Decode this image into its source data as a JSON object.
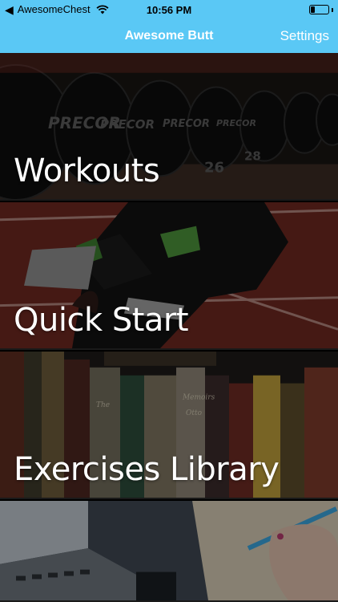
{
  "status_bar": {
    "back_glyph": "◀",
    "carrier": "AwesomeChest",
    "time": "10:56 PM",
    "battery_level": 0.25
  },
  "nav": {
    "title": "Awesome Butt",
    "settings_label": "Settings"
  },
  "menu": {
    "items": [
      {
        "label": "Workouts",
        "image": "dumbbells-photo"
      },
      {
        "label": "Quick Start",
        "image": "sprinter-start-photo"
      },
      {
        "label": "Exercises Library",
        "image": "bookshelf-photo"
      },
      {
        "label": "",
        "image": "laptop-notebook-photo"
      }
    ]
  },
  "colors": {
    "accent": "#5ac8f5",
    "nav_text": "#ffffff"
  }
}
